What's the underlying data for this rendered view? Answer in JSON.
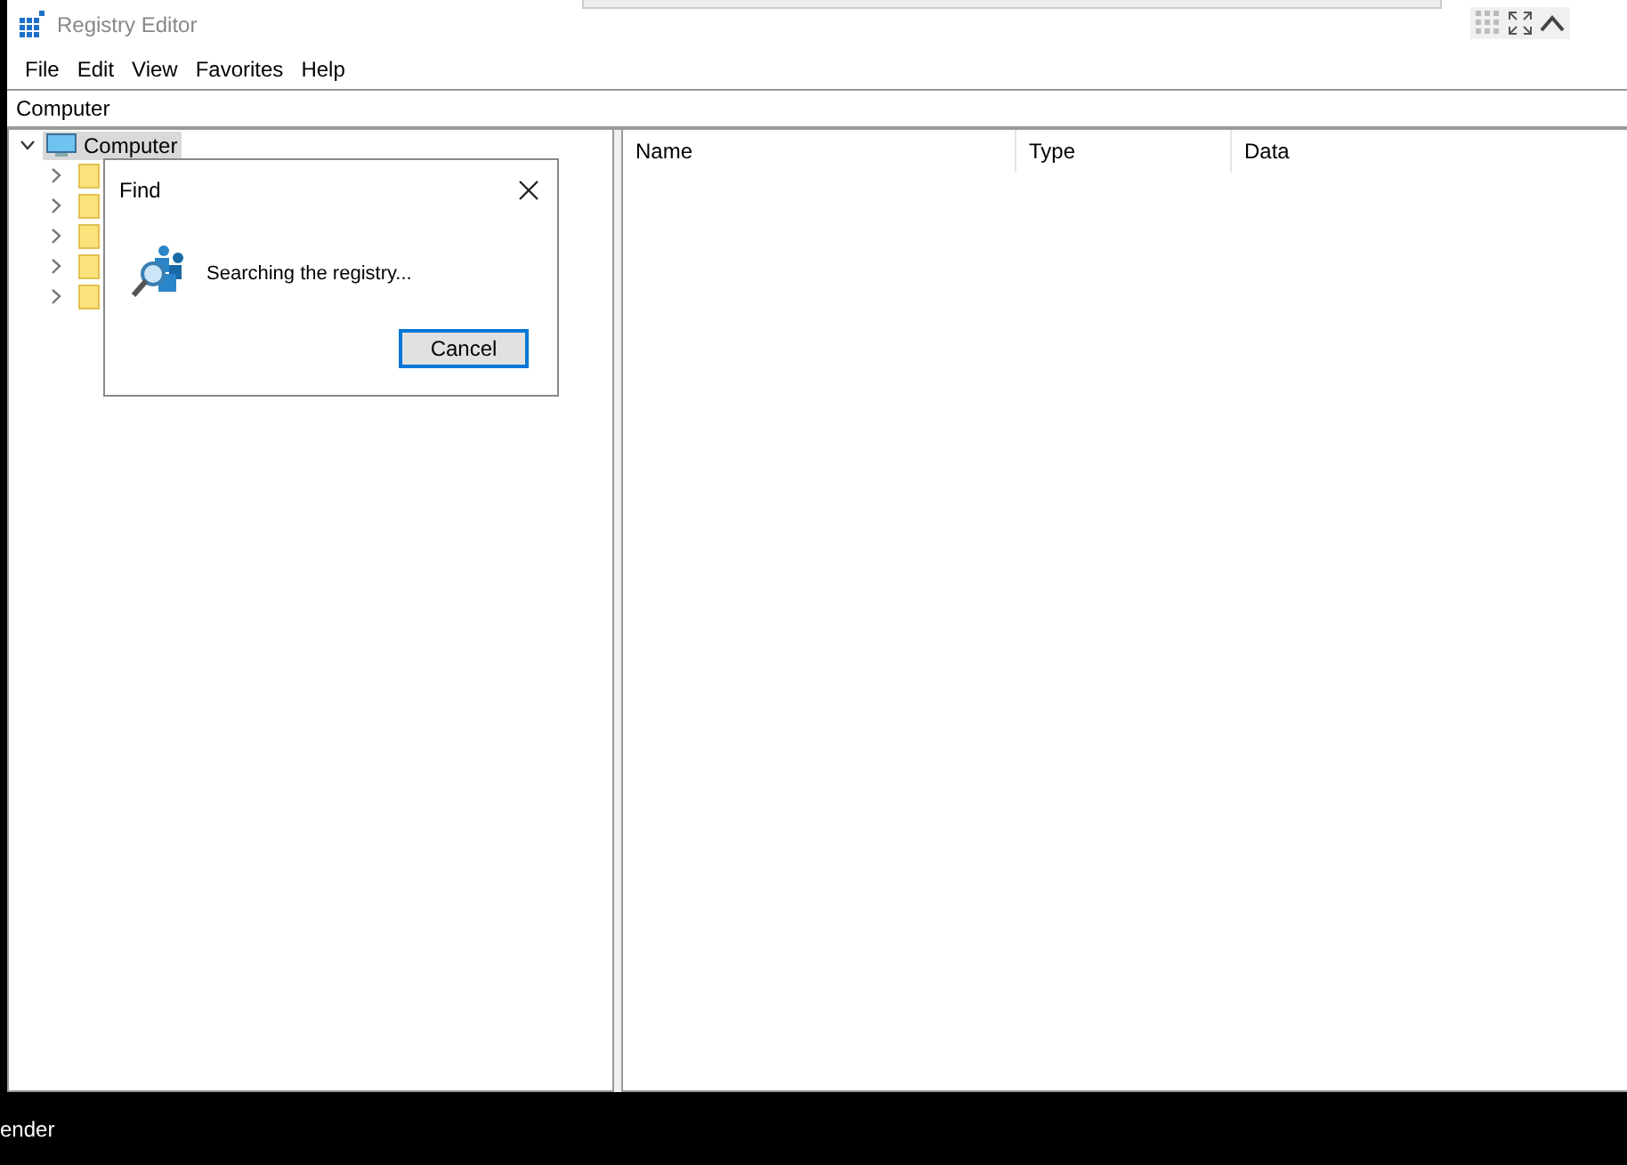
{
  "window": {
    "title": "Registry Editor"
  },
  "menu": [
    "File",
    "Edit",
    "View",
    "Favorites",
    "Help"
  ],
  "address": "Computer",
  "tree": [
    {
      "label": "Computer",
      "expanded": true,
      "selected": true,
      "children": [
        {
          "expanded": false,
          "selected": false
        },
        {
          "expanded": false,
          "selected": false
        },
        {
          "expanded": false,
          "selected": false
        },
        {
          "expanded": false,
          "selected": false
        },
        {
          "expanded": false,
          "selected": false
        }
      ]
    }
  ],
  "list": {
    "columns": [
      "Name",
      "Type",
      "Data"
    ]
  },
  "dialog": {
    "title": "Find",
    "message": "Searching the registry...",
    "buttons": [
      {
        "label": "Cancel",
        "default": true
      }
    ]
  },
  "taskbar": {
    "text": "ender"
  }
}
